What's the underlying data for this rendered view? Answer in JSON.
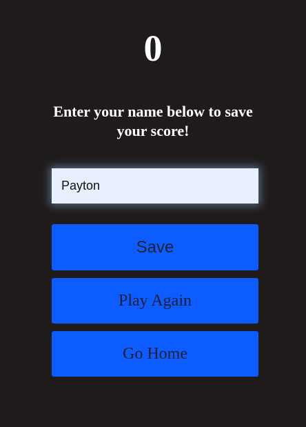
{
  "score": "0",
  "prompt": "Enter your name below to save your score!",
  "name_input": {
    "value": "Payton",
    "placeholder": ""
  },
  "buttons": {
    "save": "Save",
    "play_again": "Play Again",
    "go_home": "Go Home"
  },
  "colors": {
    "background": "#1f1b1b",
    "button": "#0d5cff",
    "input_background": "#e8f0fe",
    "text_light": "#ffffff"
  }
}
